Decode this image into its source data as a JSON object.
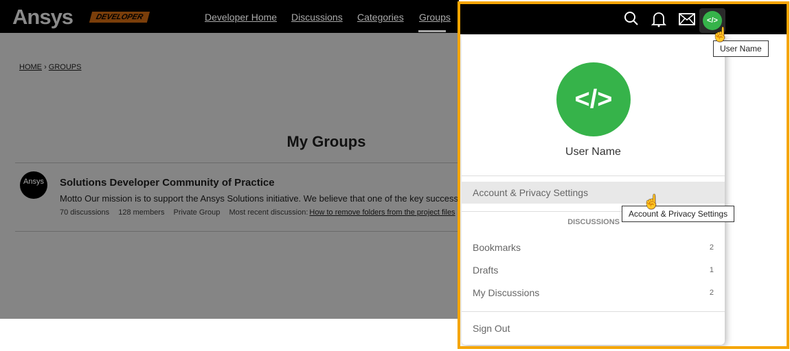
{
  "header": {
    "logo": "Ansys",
    "logo_badge": "DEVELOPER",
    "nav": [
      "Developer Home",
      "Discussions",
      "Categories",
      "Groups"
    ],
    "active_nav": "Groups"
  },
  "breadcrumb": {
    "home": "HOME",
    "sep": "›",
    "groups": "GROUPS"
  },
  "page_title": "My Groups",
  "group": {
    "avatar_text": "Ansys",
    "name": "Solutions Developer Community of Practice",
    "description": "Motto Our mission is to support the Ansys Solutions initiative. We believe that one of the key success",
    "discussions": "70 discussions",
    "members": "128 members",
    "type": "Private Group",
    "recent_label": "Most recent discussion:",
    "recent_link": "How to remove folders from the project files"
  },
  "topbar": {
    "icons": [
      "search-icon",
      "bell-icon",
      "mail-icon",
      "avatar"
    ],
    "avatar_glyph": "</>",
    "avatar_tooltip": "User Name"
  },
  "menu": {
    "avatar_glyph": "</>",
    "user_name": "User Name",
    "account": "Account & Privacy Settings",
    "account_tooltip": "Account & Privacy Settings",
    "section": "DISCUSSIONS",
    "items": [
      {
        "label": "Bookmarks",
        "count": "2"
      },
      {
        "label": "Drafts",
        "count": "1"
      },
      {
        "label": "My Discussions",
        "count": "2"
      }
    ],
    "sign_out": "Sign Out"
  },
  "colors": {
    "highlight_border": "#f5a500",
    "avatar_green": "#36b34a",
    "brand_orange": "#7a3e0a"
  }
}
